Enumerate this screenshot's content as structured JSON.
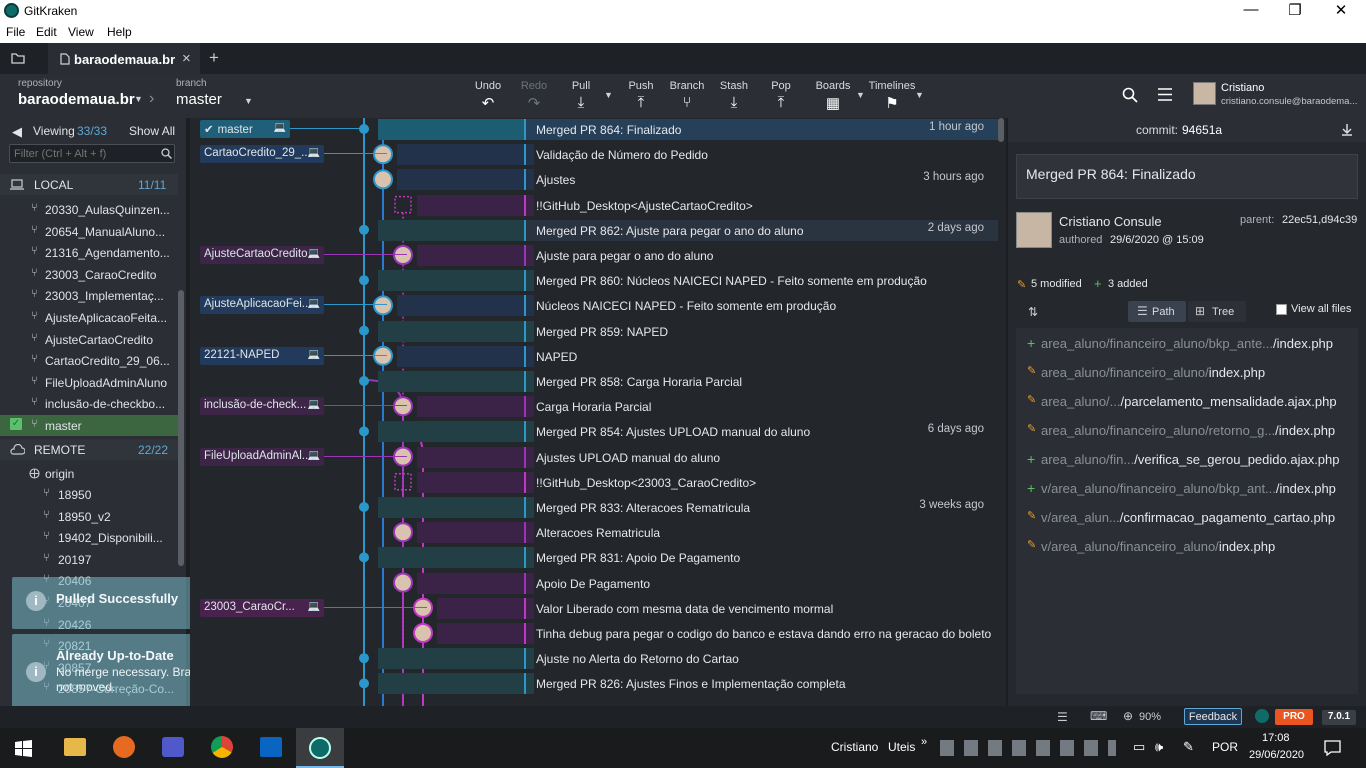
{
  "window": {
    "title": "GitKraken",
    "minimize": "—",
    "maximize": "❐",
    "close": "✕"
  },
  "menu": [
    "File",
    "Edit",
    "View",
    "Help"
  ],
  "tab": {
    "title": "baraodemaua.br",
    "close": "×",
    "add": "+"
  },
  "toolbar": {
    "repository_label": "repository",
    "repository_value": "baraodemaua.br",
    "branch_label": "branch",
    "branch_value": "master",
    "undo": "Undo",
    "redo": "Redo",
    "pull": "Pull",
    "push": "Push",
    "branch": "Branch",
    "stash": "Stash",
    "pop": "Pop",
    "boards": "Boards",
    "timelines": "Timelines",
    "user_name": "Cristiano",
    "user_email": "cristiano.consule@baraodema..."
  },
  "sidebar": {
    "viewing": "Viewing",
    "viewing_count": "33/33",
    "show_all": "Show All",
    "filter_placeholder": "Filter (Ctrl + Alt + f)",
    "local_label": "LOCAL",
    "local_count": "11/11",
    "local_branches": [
      "20330_AulasQuinzen...",
      "20654_ManualAluno...",
      "21316_Agendamento...",
      "23003_CaraoCredito",
      "23003_Implementaç...",
      "AjusteAplicacaoFeita...",
      "AjusteCartaoCredito",
      "CartaoCredito_29_06...",
      "FileUploadAdminAluno",
      "inclusão-de-checkbo...",
      "master"
    ],
    "remote_label": "REMOTE",
    "remote_count": "22/22",
    "origin": "origin",
    "remote_branches": [
      "18950",
      "18950_v2",
      "19402_Disponibili...",
      "20197",
      "20406",
      "20407",
      "20426",
      "20821",
      "20857",
      "20857-Correção-Co..."
    ]
  },
  "graph_rows": [
    {
      "label": "master",
      "msg": "Merged PR 864: Finalizado",
      "time": "1 hour ago",
      "lane": "master"
    },
    {
      "label": "CartaoCredito_29_...",
      "msg": "Validação de Número do Pedido",
      "time": "",
      "lane": "blue"
    },
    {
      "label": "",
      "msg": "Ajustes",
      "time": "3 hours ago",
      "lane": "blue"
    },
    {
      "label": "",
      "msg": "!!GitHub_Desktop<AjusteCartaoCredito>",
      "time": "",
      "lane": "stash"
    },
    {
      "label": "",
      "msg": "Merged PR 862: Ajuste para pegar o ano do aluno",
      "time": "2 days ago",
      "lane": "teal"
    },
    {
      "label": "AjusteCartaoCredito",
      "msg": "Ajuste para pegar o ano do aluno",
      "time": "",
      "lane": "purple"
    },
    {
      "label": "",
      "msg": "Merged PR 860: Núcleos NAICECI NAPED - Feito somente em produção",
      "time": "",
      "lane": "teal"
    },
    {
      "label": "AjusteAplicacaoFei...",
      "msg": "Núcleos NAICECI NAPED - Feito somente em produção",
      "time": "",
      "lane": "blue"
    },
    {
      "label": "",
      "msg": "Merged PR 859: NAPED",
      "time": "",
      "lane": "teal"
    },
    {
      "label": "22121-NAPED",
      "msg": "NAPED",
      "time": "",
      "lane": "blue"
    },
    {
      "label": "",
      "msg": "Merged PR 858: Carga Horaria Parcial",
      "time": "",
      "lane": "teal"
    },
    {
      "label": "inclusão-de-check...",
      "msg": "Carga Horaria Parcial",
      "time": "",
      "lane": "purple"
    },
    {
      "label": "",
      "msg": "Merged PR 854: Ajustes UPLOAD manual do aluno",
      "time": "6 days ago",
      "lane": "teal"
    },
    {
      "label": "FileUploadAdminAl...",
      "msg": "Ajustes UPLOAD manual do aluno",
      "time": "",
      "lane": "purple"
    },
    {
      "label": "",
      "msg": "!!GitHub_Desktop<23003_CaraoCredito>",
      "time": "",
      "lane": "stash"
    },
    {
      "label": "",
      "msg": "Merged PR 833: Alteracoes Rematricula",
      "time": "3 weeks ago",
      "lane": "teal"
    },
    {
      "label": "",
      "msg": "Alteracoes Rematricula",
      "time": "",
      "lane": "purple"
    },
    {
      "label": "",
      "msg": "Merged PR 831: Apoio De Pagamento",
      "time": "",
      "lane": "teal"
    },
    {
      "label": "",
      "msg": "Apoio De Pagamento",
      "time": "",
      "lane": "purple"
    },
    {
      "label": "23003_CaraoCr...",
      "msg": "Valor Liberado com mesma data de vencimento mormal",
      "time": "",
      "lane": "magenta"
    },
    {
      "label": "",
      "msg": "Tinha debug para pegar o codigo do banco e estava dando erro na geracao do boleto",
      "time": "",
      "lane": "magenta"
    },
    {
      "label": "",
      "msg": "Ajuste no Alerta do Retorno do Cartao",
      "time": "",
      "lane": "teal"
    },
    {
      "label": "",
      "msg": "Merged PR 826: Ajustes Finos e Implementação completa",
      "time": "",
      "lane": "teal"
    }
  ],
  "detail": {
    "commit_label": "commit:",
    "commit_hash": "94651a",
    "message": "Merged PR 864: Finalizado",
    "author": "Cristiano Consule",
    "authored": "authored",
    "date": "29/6/2020 @ 15:09",
    "parent_label": "parent:",
    "parents": "22ec51,d94c39",
    "modified": "5 modified",
    "added": "3 added",
    "path": "Path",
    "tree": "Tree",
    "view_all": "View all files",
    "files": [
      {
        "type": "add",
        "dir": "area_aluno/financeiro_aluno/bkp_ante...",
        "name": "/index.php"
      },
      {
        "type": "mod",
        "dir": "area_aluno/financeiro_aluno/",
        "name": "index.php"
      },
      {
        "type": "mod",
        "dir": "area_aluno/...",
        "name": "/parcelamento_mensalidade.ajax.php"
      },
      {
        "type": "mod",
        "dir": "area_aluno/financeiro_aluno/retorno_g...",
        "name": "/index.php"
      },
      {
        "type": "add",
        "dir": "area_aluno/fin...",
        "name": "/verifica_se_gerou_pedido.ajax.php"
      },
      {
        "type": "add",
        "dir": "v/area_aluno/financeiro_aluno/bkp_ant...",
        "name": "/index.php"
      },
      {
        "type": "mod",
        "dir": "v/area_alun...",
        "name": "/confirmacao_pagamento_cartao.php"
      },
      {
        "type": "mod",
        "dir": "v/area_aluno/financeiro_aluno/",
        "name": "index.php"
      }
    ]
  },
  "toasts": [
    {
      "title": "Pulled Successfully",
      "body": ""
    },
    {
      "title": "Already Up-to-Date",
      "body": "No merge necessary. Branch was not moved."
    }
  ],
  "statusbar": {
    "zoom": "90%",
    "feedback": "Feedback",
    "pro": "PRO",
    "version": "7.0.1"
  },
  "taskbar": {
    "user": "Cristiano",
    "uteis": "Uteis",
    "lang": "POR",
    "time": "17:08",
    "date": "29/06/2020"
  }
}
